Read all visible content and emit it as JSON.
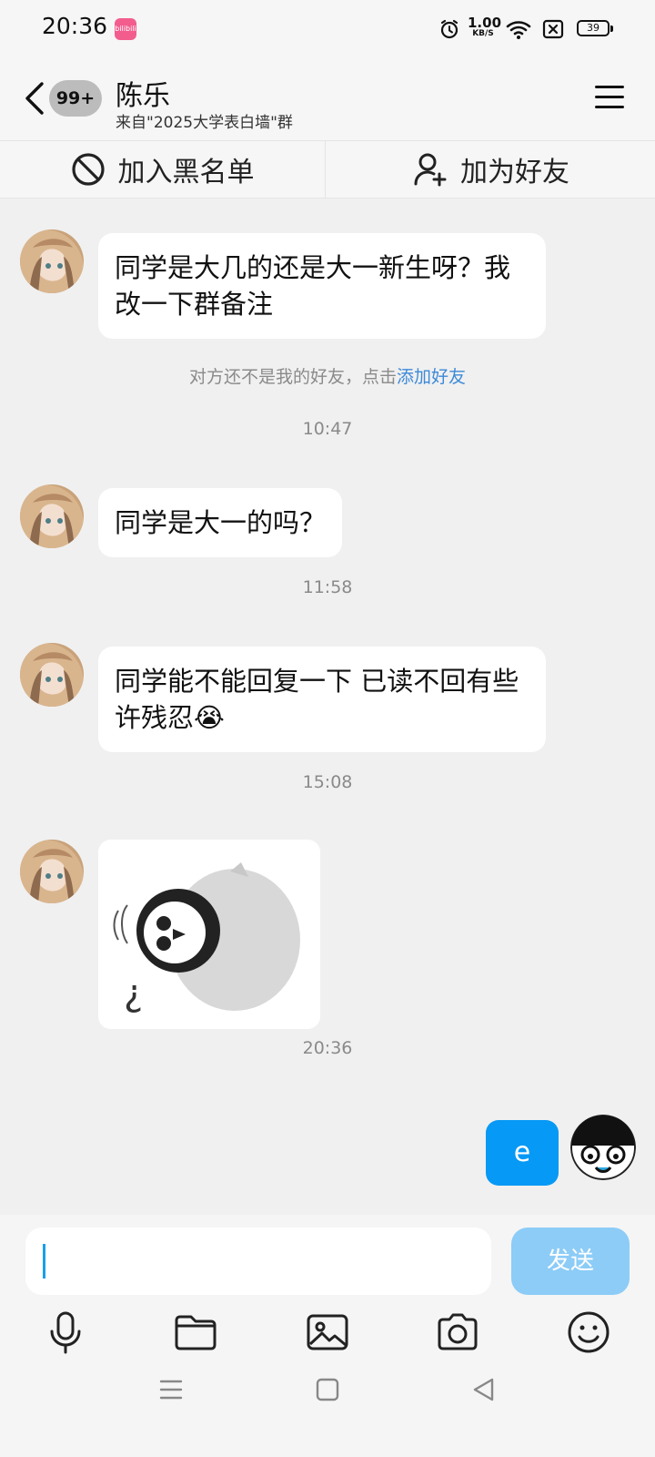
{
  "status_bar": {
    "time": "20:36",
    "app_badge": "bilibili",
    "net_speed": "1.00",
    "net_unit": "KB/S",
    "battery": "39"
  },
  "header": {
    "unread": "99+",
    "name": "陈乐",
    "source": "来自\"2025大学表白墙\"群"
  },
  "actions": {
    "block": "加入黑名单",
    "add_friend": "加为好友"
  },
  "messages": [
    {
      "text": "同学是大几的还是大一新生呀？我改一下群备注"
    },
    {
      "text": "同学是大一的吗？"
    },
    {
      "text": "同学能不能回复一下 已读不回有些许残忍😭"
    }
  ],
  "notice": {
    "text": "对方还不是我的好友，点击",
    "link": "添加好友"
  },
  "timestamps": [
    "10:47",
    "11:58",
    "15:08",
    "20:36"
  ],
  "sticker_icon": "penguin-sticker",
  "my_message": "e",
  "composer": {
    "placeholder": "",
    "send": "发送"
  },
  "toolbar_icons": [
    "microphone-icon",
    "folder-icon",
    "image-icon",
    "camera-icon",
    "emoji-icon"
  ],
  "colors": {
    "accent": "#0699f5",
    "send_disabled": "#8cccf7",
    "link": "#3d8ad8",
    "background": "#f0f0f0"
  }
}
